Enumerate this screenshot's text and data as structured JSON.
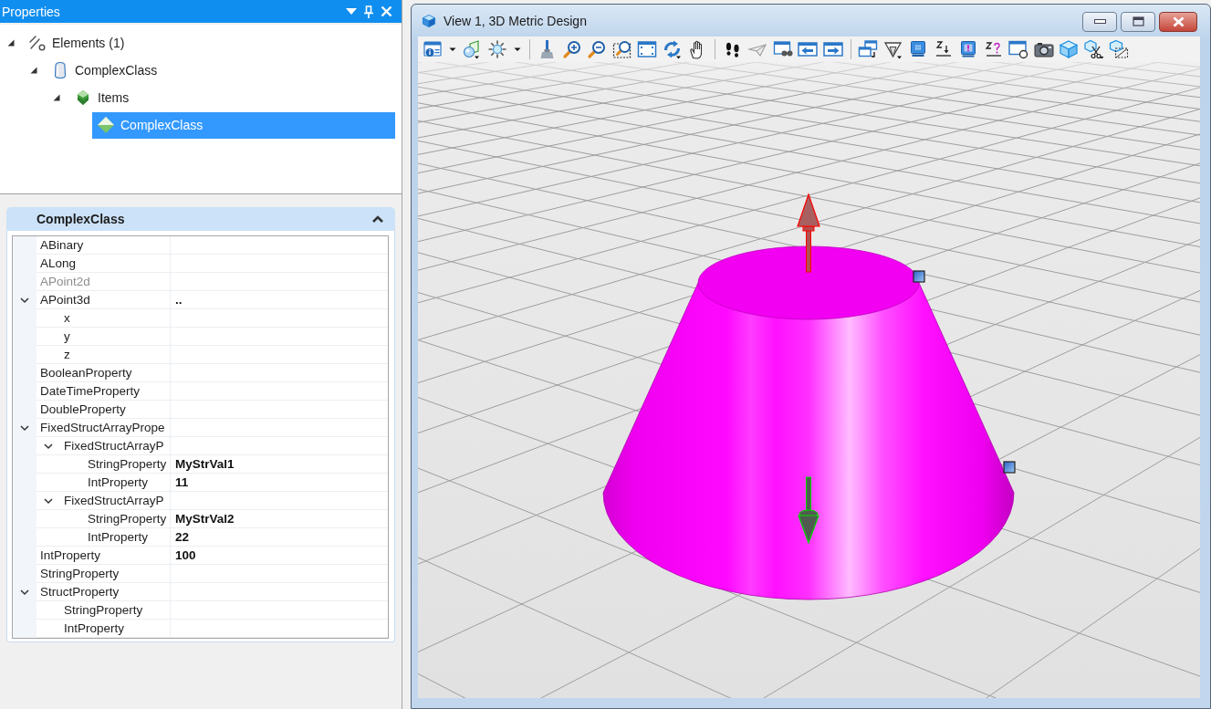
{
  "properties_panel": {
    "title": "Properties",
    "tree": [
      {
        "label": "Elements (1)",
        "kind": "set",
        "selected": false,
        "expanded": true,
        "children": [
          {
            "label": "ComplexClass",
            "kind": "element",
            "selected": false,
            "expanded": true,
            "children": [
              {
                "label": "Items",
                "kind": "group",
                "selected": false,
                "expanded": true,
                "children": [
                  {
                    "label": "ComplexClass",
                    "kind": "member",
                    "selected": true
                  }
                ]
              }
            ]
          }
        ]
      }
    ],
    "grid": {
      "title": "ComplexClass",
      "expanded": true,
      "rows": [
        {
          "name": "ABinary",
          "disabled": false
        },
        {
          "name": "ALong",
          "disabled": false
        },
        {
          "name": "APoint2d",
          "disabled": true
        },
        {
          "name": "APoint3d",
          "value": "..",
          "disabled": false,
          "expanded": true,
          "children": [
            {
              "name": "x",
              "disabled": false
            },
            {
              "name": "y",
              "disabled": false
            },
            {
              "name": "z",
              "disabled": false
            }
          ]
        },
        {
          "name": "BooleanProperty",
          "disabled": false
        },
        {
          "name": "DateTimeProperty",
          "disabled": false
        },
        {
          "name": "DoubleProperty",
          "disabled": false
        },
        {
          "name": "FixedStructArrayPrope",
          "disabled": false,
          "expanded": true,
          "children": [
            {
              "name": "FixedStructArrayP",
              "disabled": false,
              "expanded": true,
              "children": [
                {
                  "name": "StringProperty",
                  "value": "MyStrVal1",
                  "disabled": false
                },
                {
                  "name": "IntProperty",
                  "value": "11",
                  "disabled": false
                }
              ]
            },
            {
              "name": "FixedStructArrayP",
              "disabled": false,
              "expanded": true,
              "children": [
                {
                  "name": "StringProperty",
                  "value": "MyStrVal2",
                  "disabled": false
                },
                {
                  "name": "IntProperty",
                  "value": "22",
                  "disabled": false
                }
              ]
            }
          ]
        },
        {
          "name": "IntProperty",
          "value": "100",
          "disabled": false
        },
        {
          "name": "StringProperty",
          "disabled": false
        },
        {
          "name": "StructProperty",
          "disabled": false,
          "expanded": true,
          "children": [
            {
              "name": "StringProperty",
              "disabled": false
            },
            {
              "name": "IntProperty",
              "disabled": false
            }
          ]
        }
      ]
    }
  },
  "view_window": {
    "title": "View 1, 3D Metric Design"
  }
}
